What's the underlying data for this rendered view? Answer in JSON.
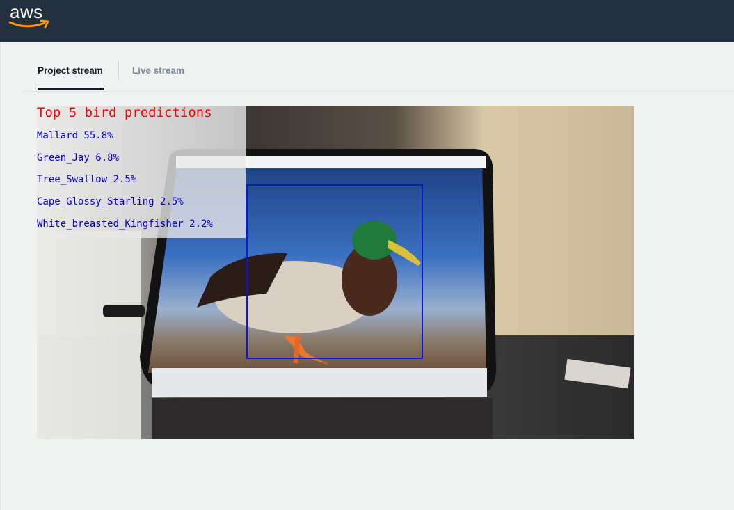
{
  "header": {
    "logo_text": "aws",
    "logo_icon": "aws-smile-arrow-icon",
    "background_color": "#232f3e"
  },
  "tabs": [
    {
      "label": "Project stream",
      "active": true
    },
    {
      "label": "Live stream",
      "active": false
    }
  ],
  "stream": {
    "overlay": {
      "title": "Top 5 bird predictions",
      "title_color": "#ff0000",
      "text_color": "#0000c8",
      "predictions": [
        "Mallard 55.8%",
        "Green_Jay 6.8%",
        "Tree_Swallow 2.5%",
        "Cape_Glossy_Starling 2.5%",
        "White_breasted_Kingfisher 2.2%"
      ]
    },
    "bounding_box_color": "#0a1ad0"
  }
}
